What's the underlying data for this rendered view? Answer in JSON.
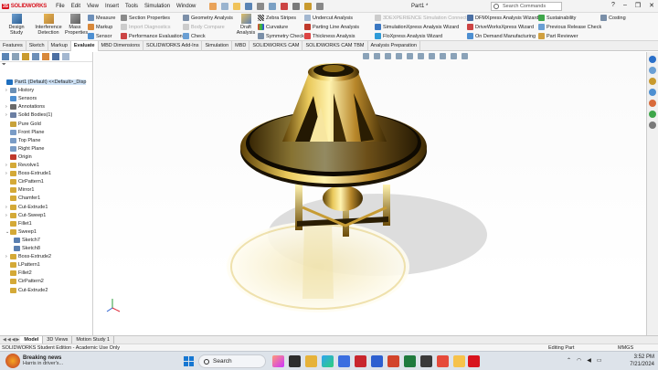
{
  "app": {
    "name": "SOLIDWORKS",
    "doc_title": "Part1 *",
    "search_placeholder": "Search Commands"
  },
  "menu": [
    "File",
    "Edit",
    "View",
    "Insert",
    "Tools",
    "Simulation",
    "Window"
  ],
  "ribbon": {
    "big_buttons": [
      "Design Study",
      "Interference Detection",
      "Mass Properties",
      "Draft Analysis"
    ],
    "items": {
      "measure": "Measure",
      "markup": "Markup",
      "sensor": "Sensor",
      "section_properties": "Section Properties",
      "import_diagnostics": "Import Diagnostics",
      "performance_evaluation": "Performance Evaluation",
      "geometry_analysis": "Geometry Analysis",
      "body_compare": "Body Compare",
      "check": "Check",
      "zebra_stripes": "Zebra Stripes",
      "curvature": "Curvature",
      "symmetry_check": "Symmetry Check",
      "undercut_analysis": "Undercut Analysis",
      "parting_line_analysis": "Parting Line Analysis",
      "thickness_analysis": "Thickness Analysis",
      "solidworks_connector": "3DEXPERIENCE Simulation Connector",
      "simulationxpress": "SimulationXpress Analysis Wizard",
      "floxpress": "FloXpress Analysis Wizard",
      "dfmxpress": "DFMXpress Analysis Wizard",
      "driveworksxpress": "DriveWorksXpress Wizard",
      "on_demand_manufacturing": "On Demand Manufacturing",
      "sustainability": "Sustainability",
      "previous_release_check": "Previous Release Check",
      "part_reviewer": "Part Reviewer",
      "costing": "Costing"
    }
  },
  "command_tabs": [
    "Features",
    "Sketch",
    "Markup",
    "Evaluate",
    "MBD Dimensions",
    "SOLIDWORKS Add-Ins",
    "Simulation",
    "MBD",
    "SOLIDWORKS CAM",
    "SOLIDWORKS CAM TBM",
    "Analysis Preparation"
  ],
  "active_tab": "Evaluate",
  "feature_tree": [
    {
      "label": "Part1 (Default) <<Default>_Disp",
      "color": "#1f6fbf"
    },
    {
      "label": "History",
      "color": "#6a8fb5"
    },
    {
      "label": "Sensors",
      "color": "#4d8fd1"
    },
    {
      "label": "Annotations",
      "color": "#6a6a6a"
    },
    {
      "label": "Solid Bodies(1)",
      "color": "#6b7fa3"
    },
    {
      "label": "Pure Gold",
      "color": "#c8a23a"
    },
    {
      "label": "Front Plane",
      "color": "#7a9cc6"
    },
    {
      "label": "Top Plane",
      "color": "#7a9cc6"
    },
    {
      "label": "Right Plane",
      "color": "#7a9cc6"
    },
    {
      "label": "Origin",
      "color": "#c0392b"
    },
    {
      "label": "Revolve1",
      "color": "#d4a937"
    },
    {
      "label": "Boss-Extrude1",
      "color": "#d4a937"
    },
    {
      "label": "CirPattern1",
      "color": "#d4a937"
    },
    {
      "label": "Mirror1",
      "color": "#d4a937"
    },
    {
      "label": "Chamfer1",
      "color": "#d4a937"
    },
    {
      "label": "Cut-Extrude1",
      "color": "#d4a937"
    },
    {
      "label": "Cut-Sweep1",
      "color": "#d4a937"
    },
    {
      "label": "Fillet1",
      "color": "#d4a937"
    },
    {
      "label": "Sweep1",
      "color": "#d4a937"
    },
    {
      "label": "Sketch7",
      "color": "#5a7fb0"
    },
    {
      "label": "Sketch8",
      "color": "#5a7fb0"
    },
    {
      "label": "Boss-Extrude2",
      "color": "#d4a937"
    },
    {
      "label": "LPattern1",
      "color": "#d4a937"
    },
    {
      "label": "Fillet2",
      "color": "#d4a937"
    },
    {
      "label": "CirPattern2",
      "color": "#d4a937"
    },
    {
      "label": "Cut-Extrude2",
      "color": "#d4a937"
    }
  ],
  "bottom_tabs": [
    "Model",
    "3D Views",
    "Motion Study 1"
  ],
  "status": {
    "left": "SOLIDWORKS Student Edition - Academic Use Only",
    "mode": "Editing Part",
    "units": "MMGS"
  },
  "taskbar": {
    "news_title": "Breaking news",
    "news_sub": "Harris in driver's...",
    "search": "Search",
    "time": "3:52 PM",
    "date": "7/21/2024"
  },
  "colors": {
    "accent": "#1677d2",
    "gold": "#c8a23a",
    "solidworks_red": "#d8141e"
  }
}
